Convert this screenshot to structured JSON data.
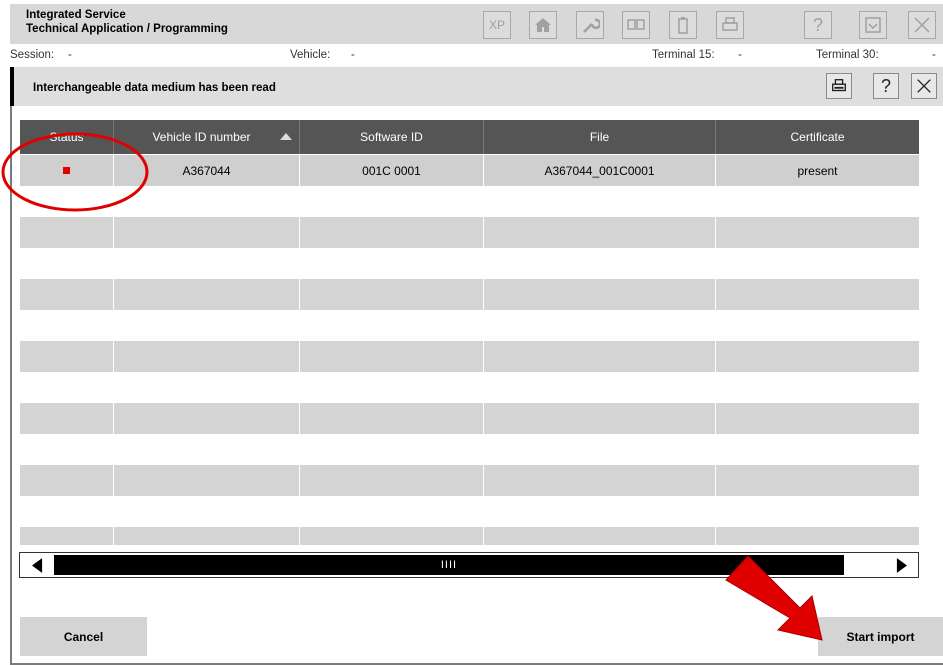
{
  "app": {
    "title_line1": "Integrated Service",
    "title_line2": "Technical Application / Programming"
  },
  "toolbar": {
    "icons": [
      "xp-button",
      "home-icon",
      "wrench-icon",
      "dual-screen-icon",
      "battery-icon",
      "printer-icon",
      "help-icon",
      "minimize-icon",
      "close-icon"
    ],
    "xp_label": "XP",
    "help_label": "?"
  },
  "info": {
    "session_label": "Session:",
    "session_value": "-",
    "vehicle_label": "Vehicle:",
    "vehicle_value": "-",
    "terminal15_label": "Terminal 15:",
    "terminal15_value": "-",
    "terminal30_label": "Terminal 30:",
    "terminal30_value": "-"
  },
  "dialog": {
    "title": "Interchangeable data medium has been read",
    "help_label": "?"
  },
  "table": {
    "columns": [
      "Status",
      "Vehicle ID number",
      "Software ID",
      "File",
      "Certificate"
    ],
    "sorted_column": "Vehicle ID number",
    "rows": [
      {
        "status": "red",
        "vehicle_id": "A367044",
        "software_id": "001C 0001",
        "file": "A367044_001C0001",
        "certificate": "present"
      }
    ]
  },
  "scrollbar": {
    "thumb_grip": "IIII"
  },
  "buttons": {
    "cancel": "Cancel",
    "start_import": "Start import"
  },
  "colors": {
    "status_error": "#e00000",
    "header_bg": "#555555",
    "annotation_red": "#e00000"
  }
}
